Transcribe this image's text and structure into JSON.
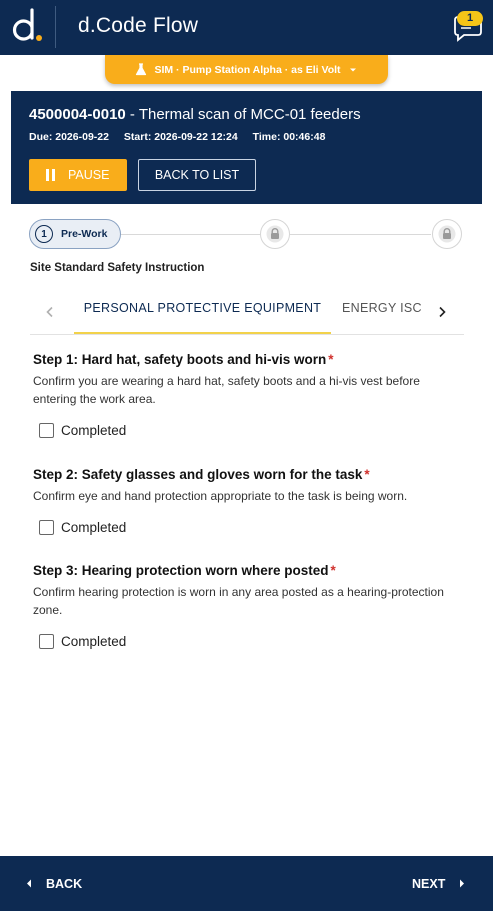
{
  "app": {
    "title": "d.Code Flow",
    "notification_count": "1"
  },
  "simulation": {
    "label": "SIM · Pump Station Alpha · as Eli Volt"
  },
  "work_order": {
    "number": "4500004-0010",
    "separator": " - ",
    "description": "Thermal scan of MCC-01 feeders",
    "due": "Due: 2026-09-22",
    "start": "Start: 2026-09-22 12:24",
    "time": "Time: 00:46:48",
    "pause_label": "PAUSE",
    "back_to_list_label": "BACK TO LIST"
  },
  "stepper": {
    "current_number": "1",
    "current_label": "Pre-Work"
  },
  "section": {
    "title": "Site Standard Safety Instruction"
  },
  "tabs": [
    {
      "label": "PERSONAL PROTECTIVE EQUIPMENT"
    },
    {
      "label": "ENERGY ISC"
    }
  ],
  "steps": [
    {
      "title": "Step 1: Hard hat, safety boots and hi-vis worn",
      "required_marker": "*",
      "description": "Confirm you are wearing a hard hat, safety boots and a hi-vis vest before entering the work area.",
      "checkbox_label": "Completed"
    },
    {
      "title": "Step 2: Safety glasses and gloves worn for the task",
      "required_marker": "*",
      "description": "Confirm eye and hand protection appropriate to the task is being worn.",
      "checkbox_label": "Completed"
    },
    {
      "title": "Step 3: Hearing protection worn where posted",
      "required_marker": "*",
      "description": "Confirm hearing protection is worn in any area posted as a hearing-protection zone.",
      "checkbox_label": "Completed"
    }
  ],
  "footer": {
    "back_label": "BACK",
    "next_label": "NEXT"
  },
  "colors": {
    "navy": "#0d2a52",
    "accent_orange": "#f9ad1b",
    "tab_underline": "#f2d24a",
    "required_red": "#d0312d"
  }
}
